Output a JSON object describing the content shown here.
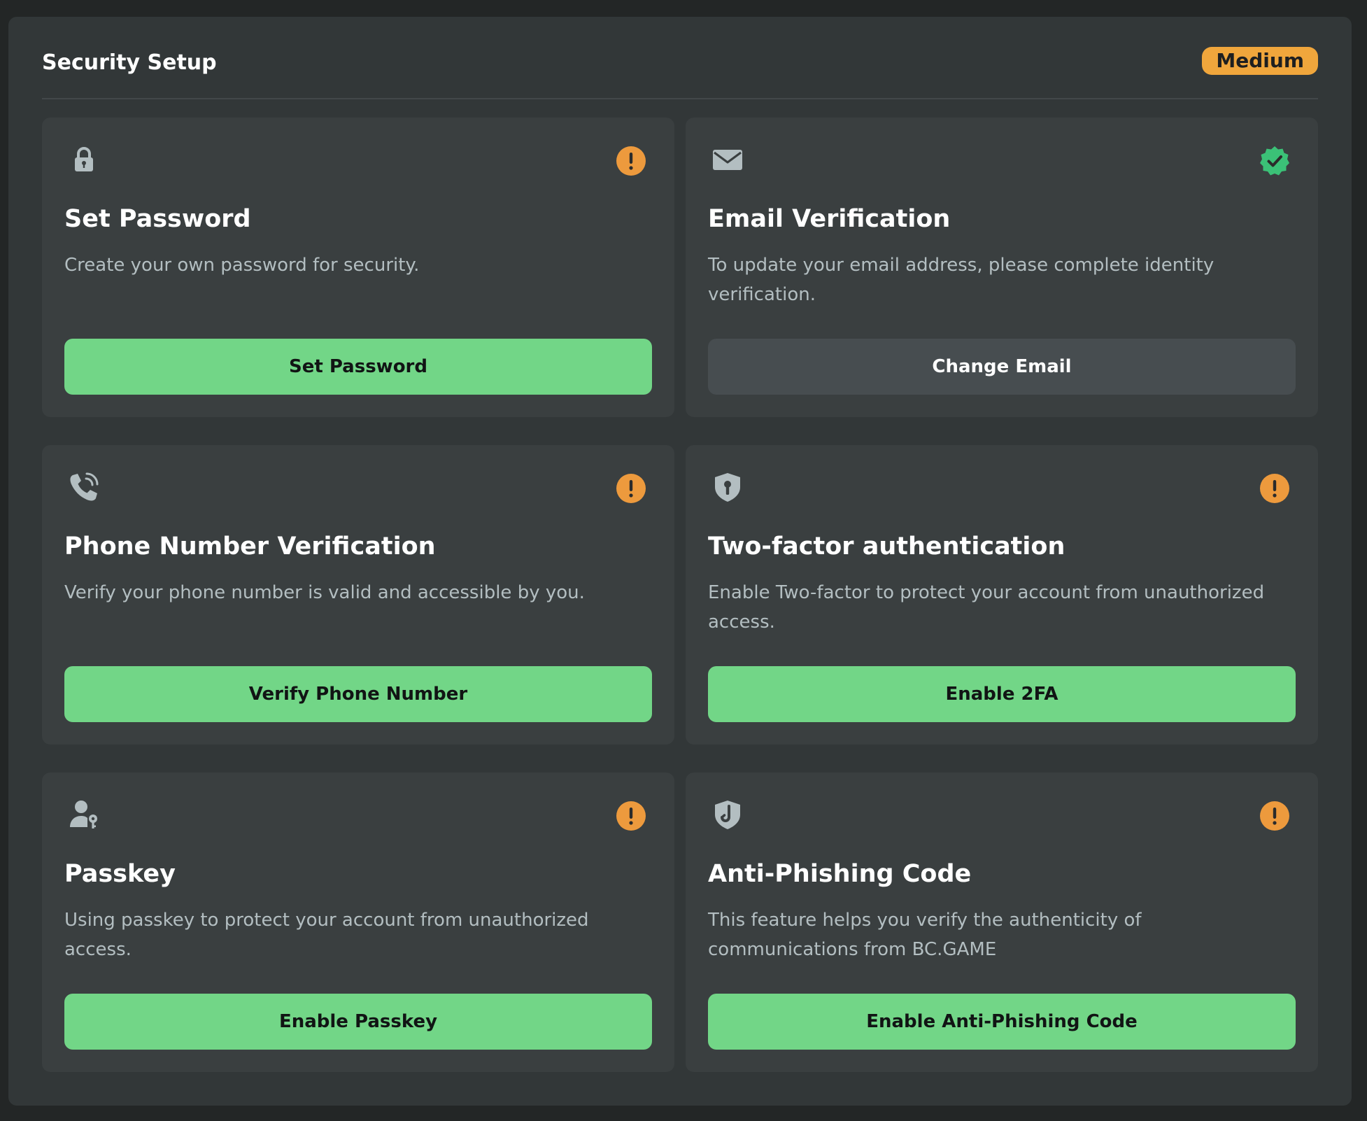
{
  "colors": {
    "page_bg": "#232626",
    "panel_bg": "#323738",
    "card_bg": "#3a3f40",
    "accent_green": "#72d687",
    "warning_orange": "#ed9a3d",
    "verified_green": "#3bc177",
    "badge_bg": "#f0a63c",
    "icon_gray": "#b3bec1",
    "secondary_button_bg": "#474d50"
  },
  "header": {
    "title": "Security Setup",
    "level_badge": "Medium"
  },
  "cards": [
    {
      "icon": "lock-icon",
      "status": "warning",
      "title": "Set Password",
      "description": "Create your own password for security.",
      "button_label": "Set Password",
      "button_style": "primary"
    },
    {
      "icon": "envelope-icon",
      "status": "verified",
      "title": "Email Verification",
      "description": "To update your email address, please complete identity verification.",
      "button_label": "Change Email",
      "button_style": "secondary"
    },
    {
      "icon": "phone-icon",
      "status": "warning",
      "title": "Phone Number Verification",
      "description": "Verify your phone number is valid and accessible by you.",
      "button_label": "Verify Phone Number",
      "button_style": "primary"
    },
    {
      "icon": "shield-keyhole-icon",
      "status": "warning",
      "title": "Two-factor authentication",
      "description": "Enable Two-factor to protect your account from unauthorized access.",
      "button_label": "Enable 2FA",
      "button_style": "primary"
    },
    {
      "icon": "user-key-icon",
      "status": "warning",
      "title": "Passkey",
      "description": "Using passkey to protect your account from unauthorized access.",
      "button_label": "Enable Passkey",
      "button_style": "primary"
    },
    {
      "icon": "shield-hook-icon",
      "status": "warning",
      "title": "Anti-Phishing Code",
      "description": "This feature helps you verify the authenticity of communications from BC.GAME",
      "button_label": "Enable Anti-Phishing Code",
      "button_style": "primary"
    }
  ]
}
